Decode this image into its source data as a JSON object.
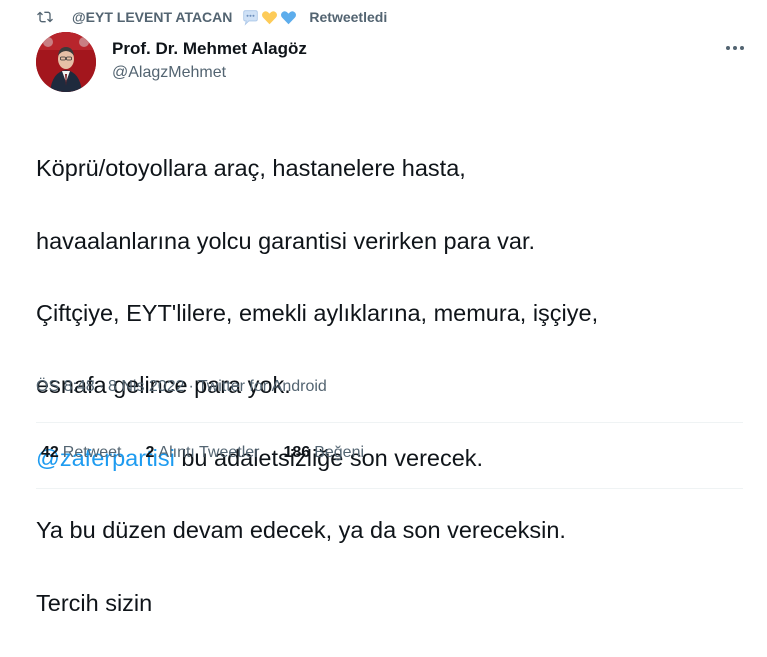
{
  "retweet": {
    "retweeter": "@EYT LEVENT ATACAN",
    "label": "Retweetledi",
    "emojis": [
      "speech-bubble",
      "yellow-heart",
      "blue-heart"
    ]
  },
  "author": {
    "name": "Prof. Dr. Mehmet Alagöz",
    "handle": "@AlagzMehmet"
  },
  "tweet": {
    "line1": "Köprü/otoyollara araç, hastanelere hasta,",
    "line2": "havaalanlarına yolcu garantisi verirken para var.",
    "line3": "Çiftçiye, EYT'lilere, emekli aylıklarına, memura, işçiye,",
    "line4": "esnafa gelince para yok.",
    "mention": "@zaferpartisi",
    "line5_rest": " bu adaletsizliğe son verecek.",
    "line6": "Ya bu düzen devam edecek, ya da son vereceksin.",
    "line7": "Tercih sizin"
  },
  "meta": {
    "time": "ÖS 8:48",
    "sep1": "·",
    "date": "8 Nis 2022",
    "sep2": "·",
    "source": "Twitter for Android"
  },
  "stats": {
    "retweets_count": "42",
    "retweets_label": "Retweet",
    "quotes_count": "2",
    "quotes_label": "Alıntı Tweetler",
    "likes_count": "186",
    "likes_label": "Beğeni"
  },
  "colors": {
    "text": "#0f1419",
    "secondary": "#536471",
    "link": "#1d9bf0",
    "divider": "#eff3f4"
  }
}
